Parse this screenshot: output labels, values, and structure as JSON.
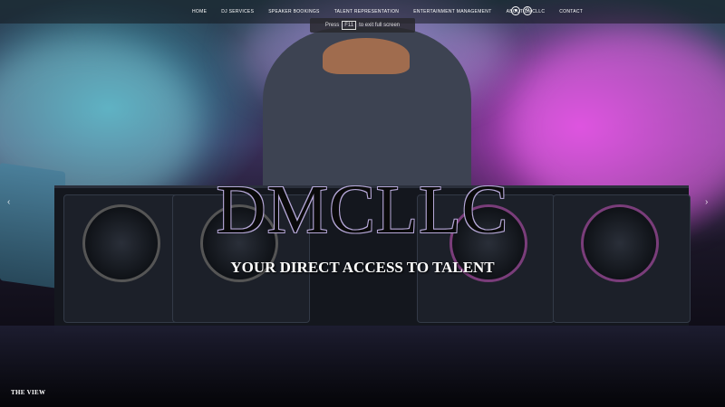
{
  "nav": {
    "items": [
      {
        "label": "HOME"
      },
      {
        "label": "DJ SERVICES"
      },
      {
        "label": "SPEAKER BOOKINGS"
      },
      {
        "label": "TALENT REPRESENTATION"
      },
      {
        "label": "ENTERTAINMENT MANAGEMENT"
      },
      {
        "label": "ABOUT DMCLLC"
      },
      {
        "label": "CONTACT"
      }
    ],
    "icons": [
      "account-icon",
      "search-icon"
    ]
  },
  "fullscreen_tip": {
    "prefix": "Press",
    "key": "F11",
    "suffix": "to exit full screen"
  },
  "hero": {
    "title": "DMCLLC",
    "tagline": "YOUR DIRECT ACCESS TO TALENT"
  },
  "footer": {
    "label": "THE VIEW"
  },
  "colors": {
    "accent_magenta": "#dc3cdc",
    "accent_cyan": "#3cb4c8",
    "nav_bg": "#14181e"
  }
}
